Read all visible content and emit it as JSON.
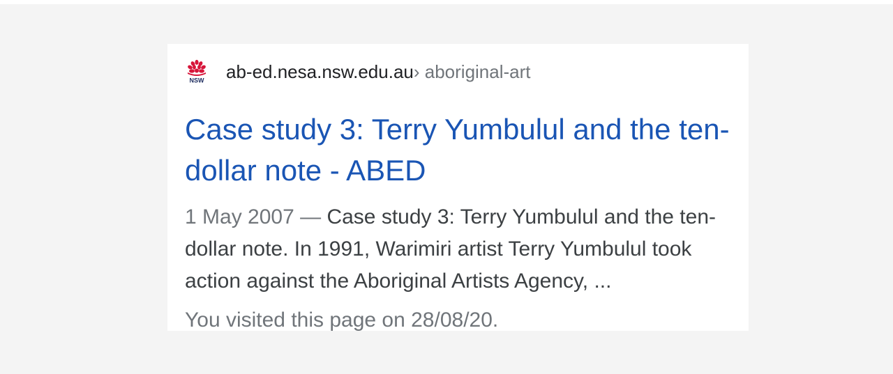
{
  "result": {
    "favicon": {
      "icon": "nsw-waratah-logo",
      "text": "NSW",
      "color": "#d7153a"
    },
    "domain": "ab-ed.nesa.nsw.edu.au",
    "breadcrumb": " › aboriginal-art",
    "title": "Case study 3: Terry Yumbulul and the ten-dollar note - ABED",
    "date": "1 May 2007",
    "date_separator": " — ",
    "snippet": "Case study 3: Terry Yumbulul and the ten-dollar note. In 1991, Warimiri artist Terry Yumbulul took action against the Aboriginal Artists Agency, ...",
    "visited_note": "You visited this page on 28/08/20."
  },
  "colors": {
    "page_background": "#f4f4f4",
    "card_background": "#ffffff",
    "title_link": "#1a55b4",
    "body_text": "#3c4043",
    "muted_text": "#70757a"
  }
}
